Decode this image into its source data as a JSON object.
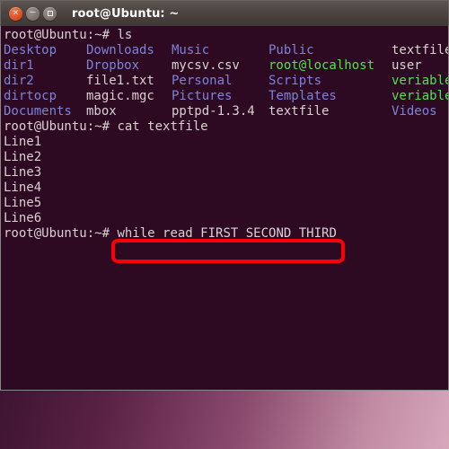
{
  "window": {
    "title": "root@Ubuntu: ~",
    "controls": [
      {
        "name": "close",
        "glyph": "×"
      },
      {
        "name": "minimize",
        "glyph": "−"
      },
      {
        "name": "maximize",
        "glyph": ""
      }
    ]
  },
  "terminal": {
    "prompt": "root@Ubuntu:~# ",
    "line_ls": {
      "prompt": "root@Ubuntu:~# ",
      "command": "ls"
    },
    "ls_output": [
      [
        {
          "text": "Desktop",
          "type": "dir"
        },
        {
          "text": "Downloads",
          "type": "dir"
        },
        {
          "text": "Music",
          "type": "dir"
        },
        {
          "text": "Public",
          "type": "dir"
        },
        {
          "text": "textfile",
          "type": "file"
        }
      ],
      [
        {
          "text": "dir1",
          "type": "dir"
        },
        {
          "text": "Dropbox",
          "type": "dir"
        },
        {
          "text": "mycsv.csv",
          "type": "file"
        },
        {
          "text": "root@localhost",
          "type": "exec"
        },
        {
          "text": "user",
          "type": "file"
        }
      ],
      [
        {
          "text": "dir2",
          "type": "dir"
        },
        {
          "text": "file1.txt",
          "type": "file"
        },
        {
          "text": "Personal",
          "type": "dir"
        },
        {
          "text": "Scripts",
          "type": "dir"
        },
        {
          "text": "veriable",
          "type": "exec"
        }
      ],
      [
        {
          "text": "dirtocp",
          "type": "dir"
        },
        {
          "text": "magic.mgc",
          "type": "file"
        },
        {
          "text": "Pictures",
          "type": "dir"
        },
        {
          "text": "Templates",
          "type": "dir"
        },
        {
          "text": "veriable",
          "type": "exec"
        }
      ],
      [
        {
          "text": "Documents",
          "type": "dir"
        },
        {
          "text": "mbox",
          "type": "file"
        },
        {
          "text": "pptpd-1.3.4",
          "type": "file"
        },
        {
          "text": "textfile",
          "type": "file"
        },
        {
          "text": "Videos",
          "type": "dir"
        }
      ]
    ],
    "line_cat": {
      "prompt": "root@Ubuntu:~# ",
      "command": "cat textfile"
    },
    "cat_output": [
      "Line1",
      "Line2",
      "Line3",
      "Line4",
      "Line5",
      "Line6"
    ],
    "line_current": {
      "prompt": "root@Ubuntu:~# ",
      "command": "while read FIRST SECOND THIRD"
    }
  },
  "annotation": {
    "color": "#fb0006",
    "highlighted_text": "while read FIRST SECOND THIRD"
  },
  "colors": {
    "terminal_background": "#2d0922",
    "directory": "#7b84d8",
    "executable": "#4fe44f",
    "default_text": "#d8d2d0",
    "titlebar": "#4b4441",
    "close_button": "#df5428"
  }
}
